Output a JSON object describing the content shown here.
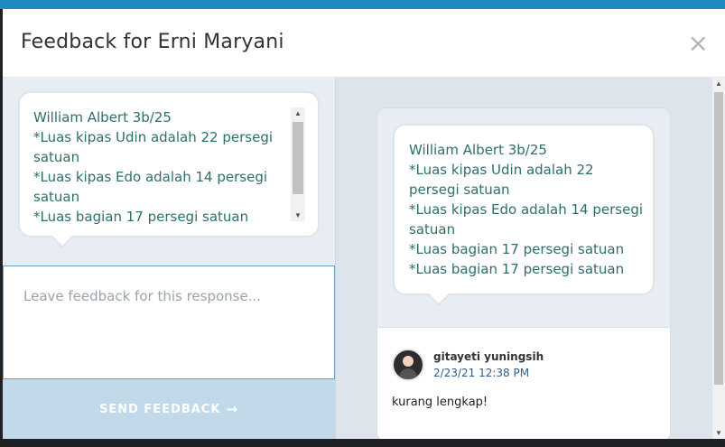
{
  "modal": {
    "title": "Feedback for Erni Maryani",
    "close_icon": "close-icon"
  },
  "response": {
    "lines": [
      "William Albert 3b/25",
      "*Luas kipas Udin adalah 22 persegi satuan",
      "*Luas kipas Edo adalah 14 persegi satuan",
      "*Luas bagian 17 persegi satuan",
      "*Luas bagian 17 persegi satuan"
    ]
  },
  "feedback_input": {
    "placeholder": "Leave feedback for this response...",
    "value": ""
  },
  "send_button": {
    "label": "SEND FEEDBACK",
    "icon": "arrow-right-icon",
    "arrow": "→"
  },
  "previous_feedback": {
    "author": "gitayeti yuningsih",
    "date": "2/23/21 12:38 PM",
    "comment": "kurang lengkap!"
  },
  "colors": {
    "accent": "#1e8bc3",
    "send_button_bg": "#c2d9e9",
    "response_text": "#2f6f6a"
  }
}
